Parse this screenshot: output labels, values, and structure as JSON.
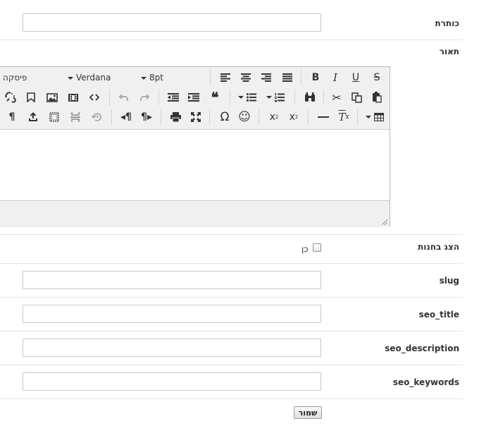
{
  "fields": {
    "title_label": "כותרת",
    "description_label": "תאור",
    "show_in_stores_label": "הצג בחנות",
    "show_in_stores_option": "כן",
    "show_in_stores_checked": false,
    "slug_label": "slug",
    "seo_title_label": "seo_title",
    "seo_description_label": "seo_description",
    "seo_keywords_label": "seo_keywords",
    "title_value": "",
    "slug_value": "",
    "seo_title_value": "",
    "seo_description_value": "",
    "seo_keywords_value": ""
  },
  "editor": {
    "format_dropdown": "פיסקה",
    "font_dropdown": "Verdana",
    "size_dropdown": "8pt",
    "toolbar_icons_row1": [
      "align-left-icon",
      "align-center-icon",
      "align-right-icon",
      "align-justify-icon",
      "bold-icon",
      "italic-icon",
      "underline-icon",
      "strikethrough-icon"
    ],
    "toolbar_icons_row2": [
      "unlink-icon",
      "bookmark-icon",
      "image-icon",
      "media-icon",
      "code-icon",
      "undo-icon",
      "redo-icon",
      "outdent-icon",
      "indent-icon",
      "blockquote-icon",
      "bullet-list-icon",
      "numbered-list-icon",
      "find-replace-icon",
      "cut-icon",
      "copy-icon",
      "paste-icon"
    ],
    "toolbar_icons_row3": [
      "paragraph-icon",
      "insert-file-icon",
      "template-icon",
      "pagebreak-icon",
      "restore-draft-icon",
      "ltr-icon",
      "rtl-icon",
      "print-icon",
      "fullscreen-icon",
      "special-char-icon",
      "emoticon-icon",
      "subscript-icon",
      "superscript-icon",
      "horizontal-rule-icon",
      "clear-format-icon",
      "table-icon"
    ]
  },
  "actions": {
    "save_label": "שמור"
  }
}
